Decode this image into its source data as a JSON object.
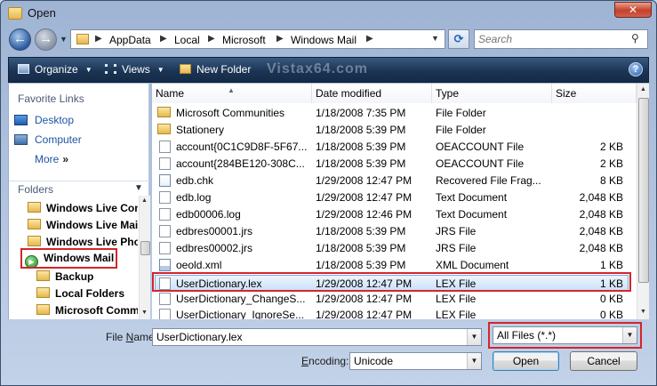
{
  "window": {
    "title": "Open",
    "close_glyph": "✕"
  },
  "address": {
    "crumbs": [
      "AppData",
      "Local",
      "Microsoft",
      "Windows Mail"
    ],
    "separator": "▶"
  },
  "search": {
    "placeholder": "Search"
  },
  "toolbar": {
    "organize_label": "Organize",
    "views_label": "Views",
    "new_folder_label": "New Folder",
    "watermark": "Vistax64.com",
    "help_glyph": "?"
  },
  "nav_pane": {
    "favorite_links_heading": "Favorite Links",
    "favorites": [
      {
        "label": "Desktop",
        "icon": "desktop-icon"
      },
      {
        "label": "Computer",
        "icon": "computer-icon"
      },
      {
        "label": "More",
        "icon": "double-chevron-right-icon"
      }
    ],
    "more_glyph": "»",
    "folders_heading": "Folders",
    "tree": [
      {
        "label": "Windows Live Contacts",
        "icon": "folder-icon"
      },
      {
        "label": "Windows Live Mail",
        "icon": "folder-icon"
      },
      {
        "label": "Windows Live Photo Gallery",
        "icon": "folder-icon"
      },
      {
        "label": "Windows Mail",
        "icon": "windows-mail-icon"
      },
      {
        "label": "Backup",
        "icon": "folder-icon"
      },
      {
        "label": "Local Folders",
        "icon": "folder-icon"
      },
      {
        "label": "Microsoft Communities",
        "icon": "folder-icon"
      }
    ]
  },
  "columns": {
    "name": "Name",
    "date": "Date modified",
    "type": "Type",
    "size": "Size"
  },
  "files": [
    {
      "name": "Microsoft Communities",
      "date": "1/18/2008 7:35 PM",
      "type": "File Folder",
      "size": "",
      "icon": "folder-icon"
    },
    {
      "name": "Stationery",
      "date": "1/18/2008 5:39 PM",
      "type": "File Folder",
      "size": "",
      "icon": "folder-icon"
    },
    {
      "name": "account{0C1C9D8F-5F67...",
      "date": "1/18/2008 5:39 PM",
      "type": "OEACCOUNT File",
      "size": "2 KB",
      "icon": "file-icon"
    },
    {
      "name": "account{284BE120-308C...",
      "date": "1/18/2008 5:39 PM",
      "type": "OEACCOUNT File",
      "size": "2 KB",
      "icon": "file-icon"
    },
    {
      "name": "edb.chk",
      "date": "1/29/2008 12:47 PM",
      "type": "Recovered File Frag...",
      "size": "8 KB",
      "icon": "system-file-icon"
    },
    {
      "name": "edb.log",
      "date": "1/29/2008 12:47 PM",
      "type": "Text Document",
      "size": "2,048 KB",
      "icon": "text-file-icon"
    },
    {
      "name": "edb00006.log",
      "date": "1/29/2008 12:46 PM",
      "type": "Text Document",
      "size": "2,048 KB",
      "icon": "text-file-icon"
    },
    {
      "name": "edbres00001.jrs",
      "date": "1/18/2008 5:39 PM",
      "type": "JRS File",
      "size": "2,048 KB",
      "icon": "file-icon"
    },
    {
      "name": "edbres00002.jrs",
      "date": "1/18/2008 5:39 PM",
      "type": "JRS File",
      "size": "2,048 KB",
      "icon": "file-icon"
    },
    {
      "name": "oeold.xml",
      "date": "1/18/2008 5:39 PM",
      "type": "XML Document",
      "size": "1 KB",
      "icon": "xml-file-icon"
    },
    {
      "name": "UserDictionary.lex",
      "date": "1/29/2008 12:47 PM",
      "type": "LEX File",
      "size": "1 KB",
      "icon": "file-icon",
      "selected": true
    },
    {
      "name": "UserDictionary_ChangeS...",
      "date": "1/29/2008 12:47 PM",
      "type": "LEX File",
      "size": "0 KB",
      "icon": "file-icon"
    },
    {
      "name": "UserDictionary_IgnoreSe...",
      "date": "1/29/2008 12:47 PM",
      "type": "LEX File",
      "size": "0 KB",
      "icon": "file-icon"
    }
  ],
  "footer": {
    "file_name_label_u": "N",
    "file_name_label_prefix": "File ",
    "file_name_label_suffix": "ame:",
    "file_name_value": "UserDictionary.lex",
    "file_type_value": "All Files (*.*)",
    "encoding_label_u": "E",
    "encoding_label_suffix": "ncoding:",
    "encoding_value": "Unicode",
    "open_label": "Open",
    "cancel_label": "Cancel"
  },
  "colors": {
    "highlight_red": "#d3252b",
    "link_blue": "#1e55a3",
    "toolbar_dark": "#1b3454"
  }
}
